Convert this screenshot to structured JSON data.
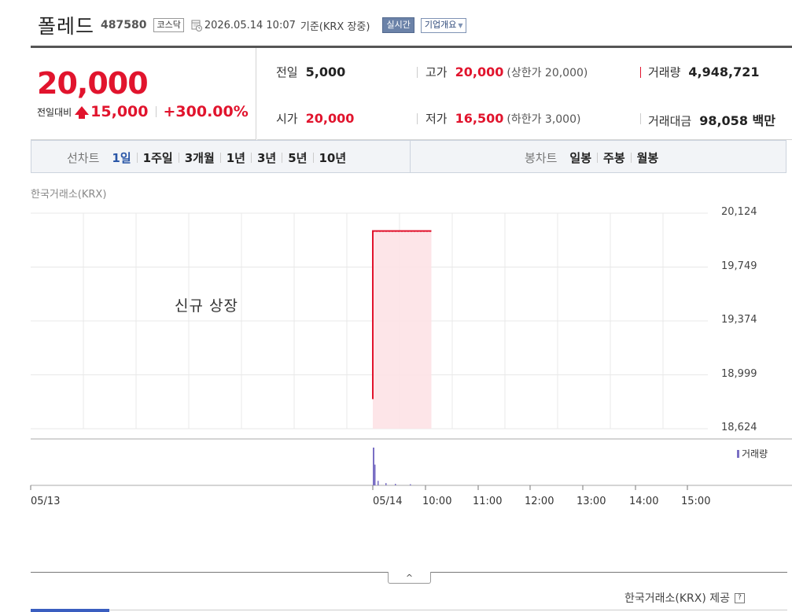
{
  "header": {
    "name": "폴레드",
    "code": "487580",
    "market": "코스닥",
    "timestamp": "2026.05.14 10:07",
    "basis": "기준(KRX 장중)",
    "realtime_label": "실시간",
    "company_label": "기업개요"
  },
  "price": {
    "current": "20,000",
    "change_label": "전일대비",
    "change": "15,000",
    "change_pct": "+300.00%"
  },
  "stats": {
    "prev_label": "전일",
    "prev": "5,000",
    "high_label": "고가",
    "high": "20,000",
    "upper_limit": "(상한가 20,000)",
    "volume_label": "거래량",
    "volume": "4,948,721",
    "open_label": "시가",
    "open": "20,000",
    "low_label": "저가",
    "low": "16,500",
    "lower_limit": "(하한가 3,000)",
    "amount_label": "거래대금",
    "amount": "98,058 백만"
  },
  "chart_nav": {
    "line_title": "선차트",
    "periods": [
      "1일",
      "1주일",
      "3개월",
      "1년",
      "3년",
      "5년",
      "10년"
    ],
    "candle_title": "봉차트",
    "candles": [
      "일봉",
      "주봉",
      "월봉"
    ]
  },
  "chart": {
    "exchange_label": "한국거래소(KRX)",
    "annotation": "신규 상장",
    "volume_legend": "거래량",
    "footer": "한국거래소(KRX) 제공",
    "help": "?",
    "toggle": "^"
  },
  "chart_data": {
    "type": "line",
    "y_ticks": [
      "20,124",
      "19,749",
      "19,374",
      "18,999",
      "18,624"
    ],
    "ylim": [
      18624,
      20124
    ],
    "x_ticks": [
      "05/13",
      "05/14",
      "10:00",
      "11:00",
      "12:00",
      "13:00",
      "14:00",
      "15:00"
    ],
    "series": [
      {
        "name": "price",
        "x": [
          "09:00",
          "09:00",
          "10:07"
        ],
        "values": [
          18830,
          20000,
          20000
        ]
      }
    ],
    "volume_series": {
      "name": "거래량",
      "values": [
        1.0,
        0.55,
        0.12,
        0.06,
        0.04,
        0.03
      ]
    },
    "colors": {
      "price": "#e1142d",
      "area": "#fde2e5",
      "volume": "#7a6fc4"
    },
    "grid": true
  }
}
